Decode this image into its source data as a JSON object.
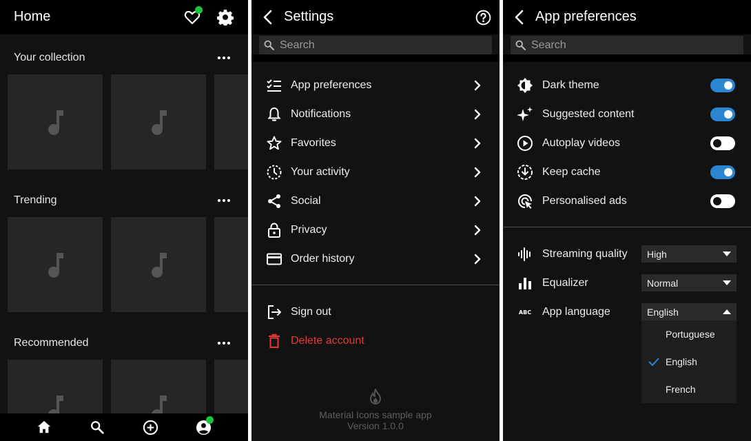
{
  "home": {
    "title": "Home",
    "sections": [
      {
        "title": "Your collection"
      },
      {
        "title": "Trending"
      },
      {
        "title": "Recommended"
      }
    ],
    "bottom_nav": [
      "home-icon",
      "search-icon",
      "add-circle-icon",
      "account-icon"
    ]
  },
  "settings": {
    "title": "Settings",
    "search_placeholder": "Search",
    "items": [
      {
        "label": "App preferences",
        "icon": "checklist-icon"
      },
      {
        "label": "Notifications",
        "icon": "bell-icon"
      },
      {
        "label": "Favorites",
        "icon": "star-icon"
      },
      {
        "label": "Your activity",
        "icon": "history-icon"
      },
      {
        "label": "Social",
        "icon": "share-icon"
      },
      {
        "label": "Privacy",
        "icon": "lock-icon"
      },
      {
        "label": "Order history",
        "icon": "credit-card-icon"
      }
    ],
    "sign_out": "Sign out",
    "delete_account": "Delete account",
    "footer_app": "Material Icons sample app",
    "footer_version": "Version 1.0.0"
  },
  "prefs": {
    "title": "App preferences",
    "search_placeholder": "Search",
    "toggles": [
      {
        "label": "Dark theme",
        "on": true
      },
      {
        "label": "Suggested content",
        "on": true
      },
      {
        "label": "Autoplay videos",
        "on": false
      },
      {
        "label": "Keep cache",
        "on": true
      },
      {
        "label": "Personalised ads",
        "on": false
      }
    ],
    "selects": [
      {
        "label": "Streaming quality",
        "value": "High"
      },
      {
        "label": "Equalizer",
        "value": "Normal"
      },
      {
        "label": "App language",
        "value": "English"
      }
    ],
    "language_options": [
      "Portuguese",
      "English",
      "French"
    ],
    "selected_language": "English"
  },
  "colors": {
    "accent": "#2a86d1",
    "danger": "#e53935",
    "badge": "#19c639",
    "background": "#121212"
  }
}
